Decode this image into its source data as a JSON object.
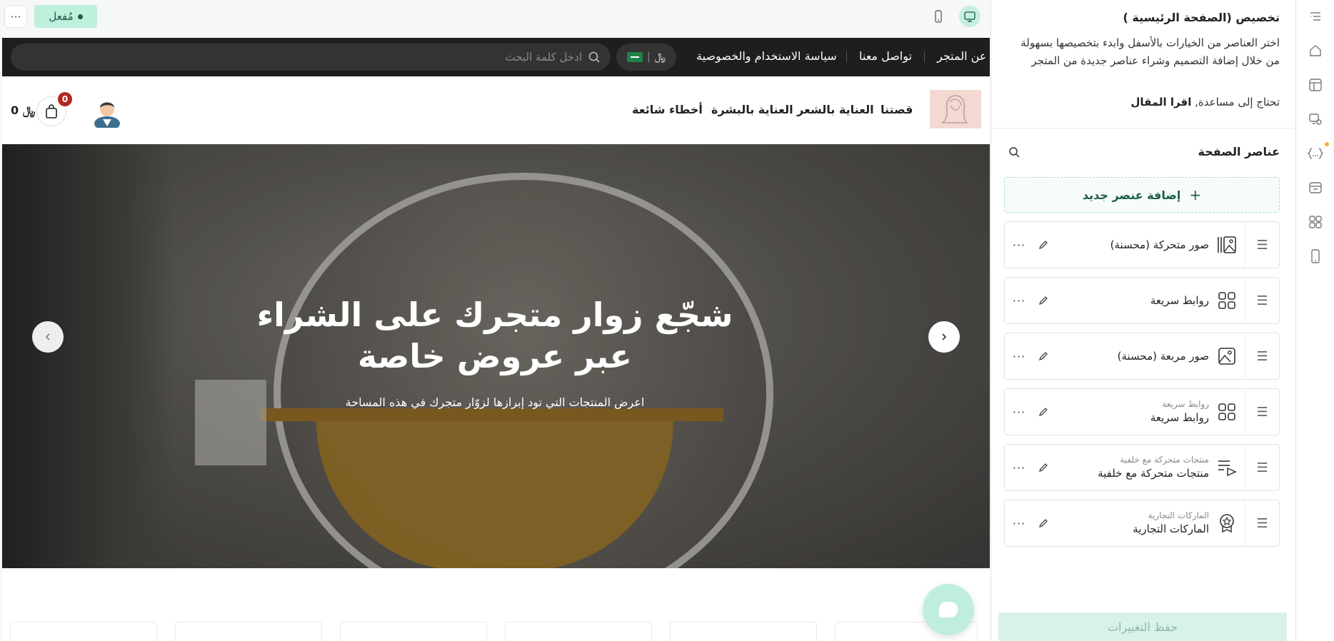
{
  "preview": {
    "status_label": "مُفعل",
    "more_label": "···"
  },
  "site": {
    "topnav": {
      "links": [
        "عن المتجر",
        "تواصل معنا",
        "سياسة الاستخدام والخصوصية"
      ],
      "currency": "﷼",
      "search_placeholder": "ادخل كلمة البحث"
    },
    "mainnav": {
      "links": [
        "قصتنا",
        "العناية بالشعر",
        "العناية بالبشرة",
        "أخطاء شائعة"
      ],
      "cart_count": "0",
      "cart_total": "0 ﷼"
    },
    "hero": {
      "title": "شجّع زوار متجرك على الشراء عبر عروض خاصة",
      "subtitle": "اعرض المنتجات التي تود إبرازها لزوّار متجرك في هذه المساحة"
    }
  },
  "panel": {
    "title": "تخصيص (الصفحة الرئيسية )",
    "description": "اختر العناصر من الخيارات بالأسفل وابدء بتخصيصها بسهولة من خلال إضافة التصميم وشراء عناصر جديدة من المتجر",
    "help_text": "تحتاج إلى مساعدة,",
    "help_link": "اقرا المقال",
    "elements_title": "عناصر الصفحة",
    "add_element": "إضافة عنصر جديد",
    "elements": [
      {
        "subtitle": "",
        "name": "صور متحركة (محسنة)",
        "icon": "gallery-icon"
      },
      {
        "subtitle": "",
        "name": "روابط سريعة",
        "icon": "grid-icon"
      },
      {
        "subtitle": "",
        "name": "صور مربعة (محسنة)",
        "icon": "image-icon"
      },
      {
        "subtitle": "روابط سريعة",
        "name": "روابط سريعة",
        "icon": "grid-icon"
      },
      {
        "subtitle": "منتجات متحركة مع خلفية",
        "name": "منتجات متحركة مع خلفية",
        "icon": "playlist-icon"
      },
      {
        "subtitle": "الماركات التجارية",
        "name": "الماركات التجارية",
        "icon": "badge-icon"
      }
    ],
    "save_label": "حفظ التغييرات"
  },
  "rail": {
    "icons": [
      "list-icon",
      "home-icon",
      "layout-icon",
      "palette-icon",
      "code-icon",
      "store-icon",
      "apps-icon",
      "mobile-icon"
    ]
  },
  "colors": {
    "accent": "#1d5c4b",
    "accent_light": "#bff0dc",
    "dark_nav": "#1e1e1e",
    "cart_badge": "#b02a1f"
  }
}
